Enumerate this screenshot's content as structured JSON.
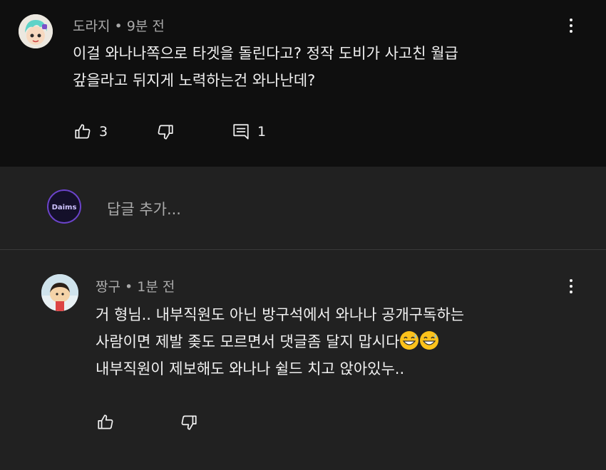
{
  "comment": {
    "author": "도라지",
    "time": "9분 전",
    "lines": [
      "이걸 와나나쪽으로 타겟을 돌린다고? 정작 도비가 사고친 월급",
      "갚을라고 뒤지게 노력하는건 와나난데?"
    ],
    "like_count": "3",
    "reply_count": "1"
  },
  "reply_box": {
    "avatar_text": "Daims",
    "placeholder": "답글 추가..."
  },
  "reply": {
    "author": "짱구",
    "time": "1분 전",
    "lines": [
      "거 형님.. 내부직원도 아닌 방구석에서 와나나 공개구독하는",
      "사람이면 제발 좆도 모르면서 댓글좀 달지 맙시다",
      "내부직원이 제보해도 와나나 쉴드 치고 앉아있누.."
    ]
  },
  "icons": {
    "like": "thumbs-up-icon",
    "dislike": "thumbs-down-icon",
    "reply": "comment-icon",
    "more": "more-vertical-icon",
    "emoji": "grinning-sweat-emoji"
  },
  "colors": {
    "background": "#0f0f0f",
    "reply_background": "#212121",
    "text": "#f1f1f1",
    "secondary_text": "#aaaaaa"
  }
}
